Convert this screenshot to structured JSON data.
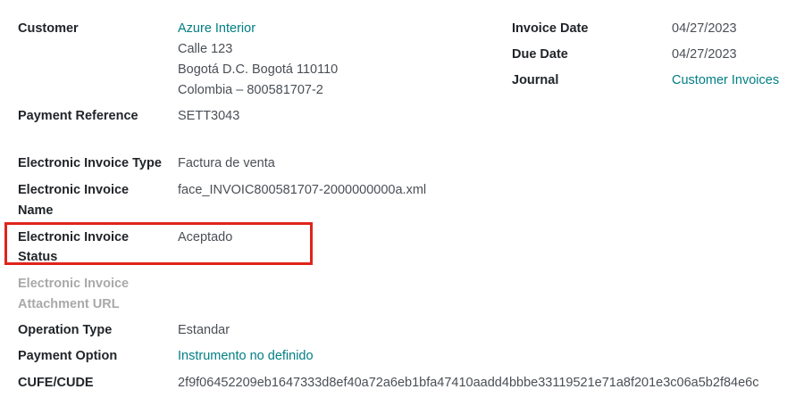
{
  "left_fields": {
    "customer": {
      "label": "Customer",
      "name": "Azure Interior",
      "address_line1": "Calle 123",
      "address_line2": "Bogotá D.C. Bogotá 110110",
      "address_line3": "Colombia – 800581707-2"
    },
    "payment_reference": {
      "label": "Payment Reference",
      "value": "SETT3043"
    },
    "einvoice_type": {
      "label": "Electronic Invoice Type",
      "value": "Factura de venta"
    },
    "einvoice_name": {
      "label_line1": "Electronic Invoice",
      "label_line2": "Name",
      "value": "face_INVOIC800581707-2000000000a.xml"
    },
    "einvoice_status": {
      "label_line1": "Electronic Invoice",
      "label_line2": "Status",
      "value": "Aceptado"
    },
    "einvoice_attachment": {
      "label_line1": "Electronic Invoice",
      "label_line2": "Attachment URL",
      "value": ""
    },
    "operation_type": {
      "label": "Operation Type",
      "value": "Estandar"
    },
    "payment_option": {
      "label": "Payment Option",
      "value": "Instrumento no definido"
    },
    "cufe": {
      "label": "CUFE/CUDE",
      "value": "2f9f06452209eb1647333d8ef40a72a6eb1bfa47410aadd4bbbe33119521e71a8f201e3c06a5b2f84e6c"
    }
  },
  "right_fields": {
    "invoice_date": {
      "label": "Invoice Date",
      "value": "04/27/2023"
    },
    "due_date": {
      "label": "Due Date",
      "value": "04/27/2023"
    },
    "journal": {
      "label": "Journal",
      "value": "Customer Invoices"
    }
  },
  "colors": {
    "link": "#017e84",
    "highlight": "#e0241b",
    "label": "#212529",
    "muted_label": "#a9a9a9"
  }
}
